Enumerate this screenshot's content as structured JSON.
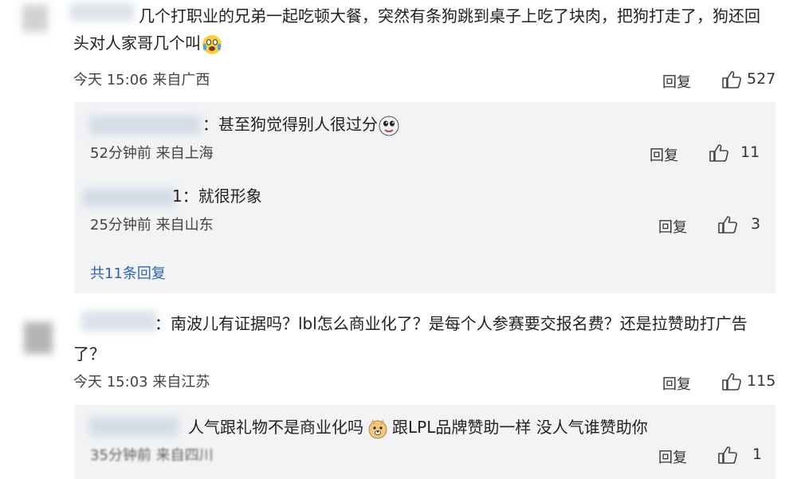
{
  "comments": [
    {
      "text_line1": "几个打职业的兄弟一起吃顿大餐，突然有条狗跳到桌子上吃了块肉，把狗打走了，狗还回",
      "text_line2": "头对人家哥几个叫",
      "emoji": "scared-face-emoji",
      "time": "今天 15:06",
      "location": "来自广西",
      "reply_label": "回复",
      "likes": "527",
      "replies": [
        {
          "name_suffix": "：",
          "text": "甚至狗觉得别人很过分",
          "emoji": "ghost-emoji",
          "time": "52分钟前",
          "location": "来自上海",
          "reply_label": "回复",
          "likes": "11"
        },
        {
          "name_suffix": "1：",
          "text": "就很形象",
          "time": "25分钟前",
          "location": "来自山东",
          "reply_label": "回复",
          "likes": "3"
        }
      ],
      "more_replies": "共11条回复"
    },
    {
      "text_line1": "：南波儿有证据吗？lbl怎么商业化了？是每个人参赛要交报名费？还是拉赞助打广告",
      "text_line2": "了？",
      "time": "今天 15:03",
      "location": "来自江苏",
      "reply_label": "回复",
      "likes": "115",
      "replies": [
        {
          "text_a": "人气跟礼物不是商业化吗",
          "emoji": "doge-emoji",
          "text_b": "跟LPL品牌赞助一样 没人气谁赞助你",
          "time": "35分钟前",
          "location": "来自四川",
          "reply_label": "回复",
          "likes": "1"
        }
      ]
    }
  ],
  "colors": {
    "link": "#2f64b3",
    "panel": "#f2f3f5"
  }
}
